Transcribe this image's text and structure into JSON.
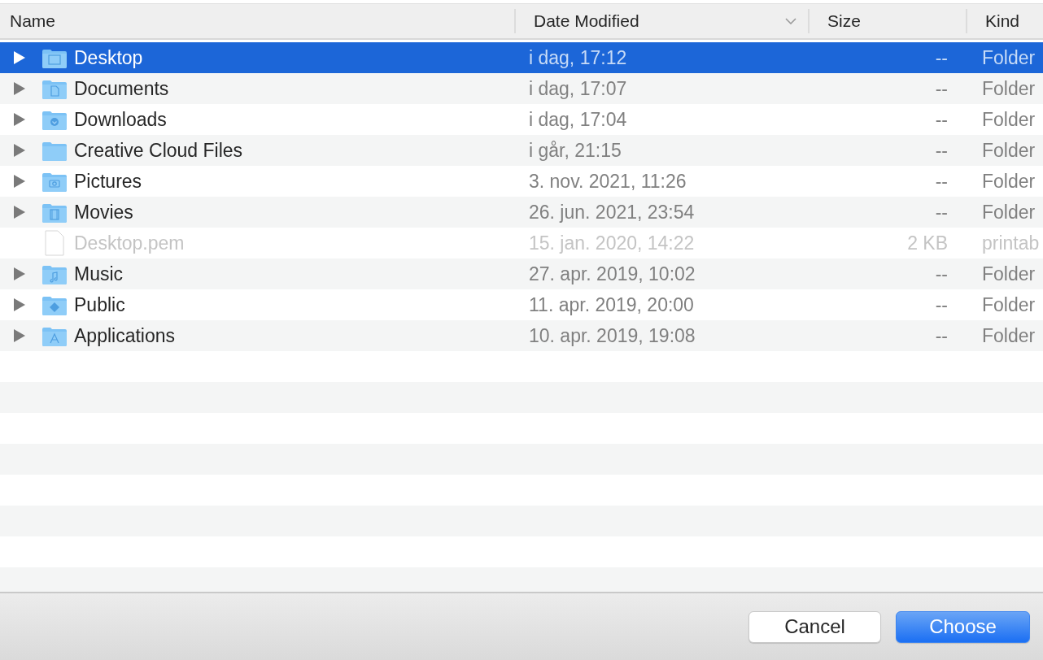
{
  "columns": [
    {
      "label": "Name",
      "sorted": false
    },
    {
      "label": "Date Modified",
      "sorted": true
    },
    {
      "label": "Size",
      "sorted": false
    },
    {
      "label": "Kind",
      "sorted": false
    }
  ],
  "rows": [
    {
      "kind": "folder",
      "name": "Desktop",
      "date": "i dag, 17:12",
      "size": "--",
      "type": "Folder",
      "selected": true,
      "disabled": false
    },
    {
      "kind": "folder",
      "name": "Documents",
      "date": "i dag, 17:07",
      "size": "--",
      "type": "Folder",
      "selected": false,
      "disabled": false
    },
    {
      "kind": "folder",
      "name": "Downloads",
      "date": "i dag, 17:04",
      "size": "--",
      "type": "Folder",
      "selected": false,
      "disabled": false
    },
    {
      "kind": "folder",
      "name": "Creative Cloud Files",
      "date": "i går, 21:15",
      "size": "--",
      "type": "Folder",
      "selected": false,
      "disabled": false
    },
    {
      "kind": "folder",
      "name": "Pictures",
      "date": "3. nov. 2021, 11:26",
      "size": "--",
      "type": "Folder",
      "selected": false,
      "disabled": false
    },
    {
      "kind": "folder",
      "name": "Movies",
      "date": "26. jun. 2021, 23:54",
      "size": "--",
      "type": "Folder",
      "selected": false,
      "disabled": false
    },
    {
      "kind": "file",
      "name": "Desktop.pem",
      "date": "15. jan. 2020, 14:22",
      "size": "2 KB",
      "type": "printab",
      "selected": false,
      "disabled": true
    },
    {
      "kind": "folder",
      "name": "Music",
      "date": "27. apr. 2019, 10:02",
      "size": "--",
      "type": "Folder",
      "selected": false,
      "disabled": false
    },
    {
      "kind": "folder",
      "name": "Public",
      "date": "11. apr. 2019, 20:00",
      "size": "--",
      "type": "Folder",
      "selected": false,
      "disabled": false
    },
    {
      "kind": "folder",
      "name": "Applications",
      "date": "10. apr. 2019, 19:08",
      "size": "--",
      "type": "Folder",
      "selected": false,
      "disabled": false
    }
  ],
  "buttons": [
    {
      "label": "Cancel",
      "primary": false
    },
    {
      "label": "Choose",
      "primary": true
    }
  ]
}
